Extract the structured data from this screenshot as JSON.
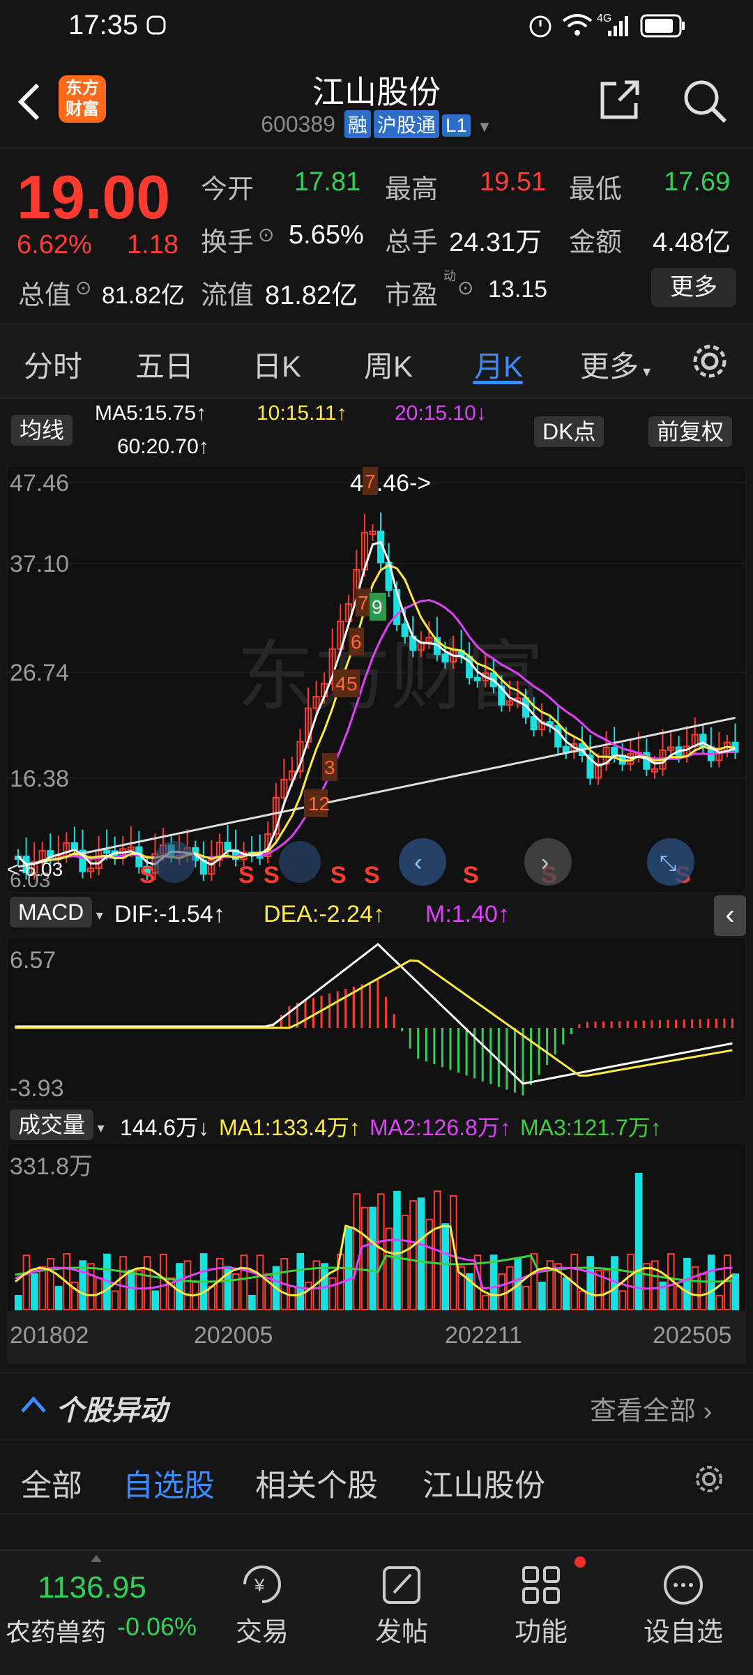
{
  "status": {
    "time": "17:35",
    "network": "4G"
  },
  "header": {
    "app_logo": "东方财富",
    "title": "江山股份",
    "code": "600389",
    "tags": [
      "融",
      "沪股通",
      "L1"
    ]
  },
  "quote": {
    "price": "19.00",
    "change_pct": "6.62%",
    "change_amt": "1.18",
    "open_label": "今开",
    "open": "17.81",
    "high_label": "最高",
    "high": "19.51",
    "low_label": "最低",
    "low": "17.69",
    "turnover_label": "换手",
    "turnover": "5.65%",
    "volume_label": "总手",
    "volume": "24.31万",
    "amount_label": "金额",
    "amount": "4.48亿",
    "mktcap_label": "总值",
    "mktcap": "81.82亿",
    "float_label": "流值",
    "float": "81.82亿",
    "pe_label": "市盈",
    "pe_sup": "动",
    "pe": "13.15",
    "more": "更多"
  },
  "tabs": [
    "分时",
    "五日",
    "日K",
    "周K",
    "月K",
    "更多"
  ],
  "active_tab": "月K",
  "ma_bar": {
    "label": "均线",
    "ma5": "MA5:15.75↑",
    "ma10": "10:15.11↑",
    "ma20": "20:15.10↓",
    "ma60": "60:20.70↑",
    "dk": "DK点",
    "adjust": "前复权"
  },
  "kline": {
    "y_ticks": [
      "47.46",
      "37.10",
      "26.74",
      "16.38",
      "6.03"
    ],
    "max_label": "47.46->",
    "min_label": "<-6.03",
    "watermark": "东方财富",
    "markers": [
      "12",
      "3",
      "4",
      "5",
      "6",
      "7",
      "9",
      "7"
    ]
  },
  "macd": {
    "label": "MACD",
    "dif": "DIF:-1.54↑",
    "dea": "DEA:-2.24↑",
    "m": "M:1.40↑",
    "y_top": "6.57",
    "y_bottom": "-3.93"
  },
  "vol": {
    "label": "成交量",
    "value": "144.6万↓",
    "ma1": "MA1:133.4万↑",
    "ma2": "MA2:126.8万↑",
    "ma3": "MA3:121.7万↑",
    "y_top": "331.8万",
    "x_ticks": [
      "201802",
      "202005",
      "202211",
      "202505"
    ]
  },
  "section": {
    "title": "个股异动",
    "link": "查看全部"
  },
  "subtabs": [
    "全部",
    "自选股",
    "相关个股",
    "江山股份"
  ],
  "active_subtab": "自选股",
  "bottom": {
    "index_value": "1136.95",
    "index_name": "农药兽药",
    "index_change": "-0.06%",
    "nav": [
      "交易",
      "发帖",
      "功能",
      "设自选"
    ]
  },
  "colors": {
    "up": "#ff3b30",
    "down": "#30d158",
    "accent": "#3b8cff",
    "ma_yellow": "#ffeb3b",
    "ma_magenta": "#e040fb"
  }
}
